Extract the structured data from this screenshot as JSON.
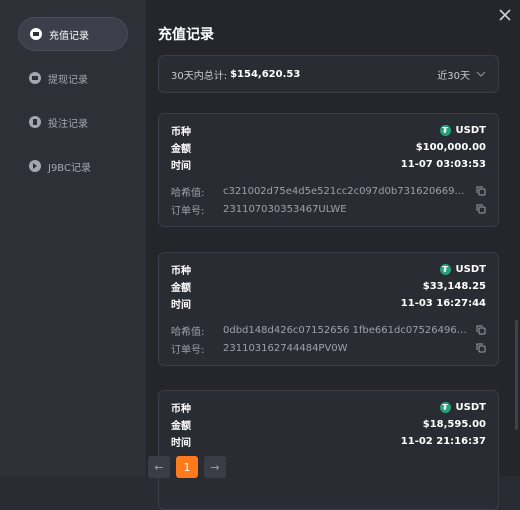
{
  "sidebar": {
    "items": [
      {
        "label": "充值记录",
        "icon": "deposit-icon",
        "active": true
      },
      {
        "label": "提现记录",
        "icon": "withdraw-icon",
        "active": false
      },
      {
        "label": "投注记录",
        "icon": "bet-icon",
        "active": false
      },
      {
        "label": "J9BC记录",
        "icon": "j9bc-icon",
        "active": false
      }
    ]
  },
  "main": {
    "title": "充值记录",
    "summary": {
      "label": "30天内总计:",
      "amount": "$154,620.53",
      "period": "近30天"
    },
    "labels": {
      "currency": "币种",
      "amount": "金额",
      "time": "时间",
      "hash": "哈希值:",
      "order": "订单号:"
    },
    "records": [
      {
        "currency": "USDT",
        "amount": "$100,000.00",
        "time": "11-07 03:03:53",
        "hash": "c321002d75e4d5e521cc2c097d0b73162066982ce...",
        "order": "231107030353467ULWE"
      },
      {
        "currency": "USDT",
        "amount": "$33,148.25",
        "time": "11-03 16:27:44",
        "hash": "0dbd148d426c07152656 1fbe661dc07526496df8e...",
        "order": "231103162744484PV0W"
      },
      {
        "currency": "USDT",
        "amount": "$18,595.00",
        "time": "11-02 21:16:37",
        "hash": "",
        "order": ""
      }
    ]
  },
  "pagination": {
    "prev": "←",
    "current": "1",
    "next": "→"
  },
  "colors": {
    "accent": "#ff7a1a",
    "usdt": "#26a17b"
  }
}
